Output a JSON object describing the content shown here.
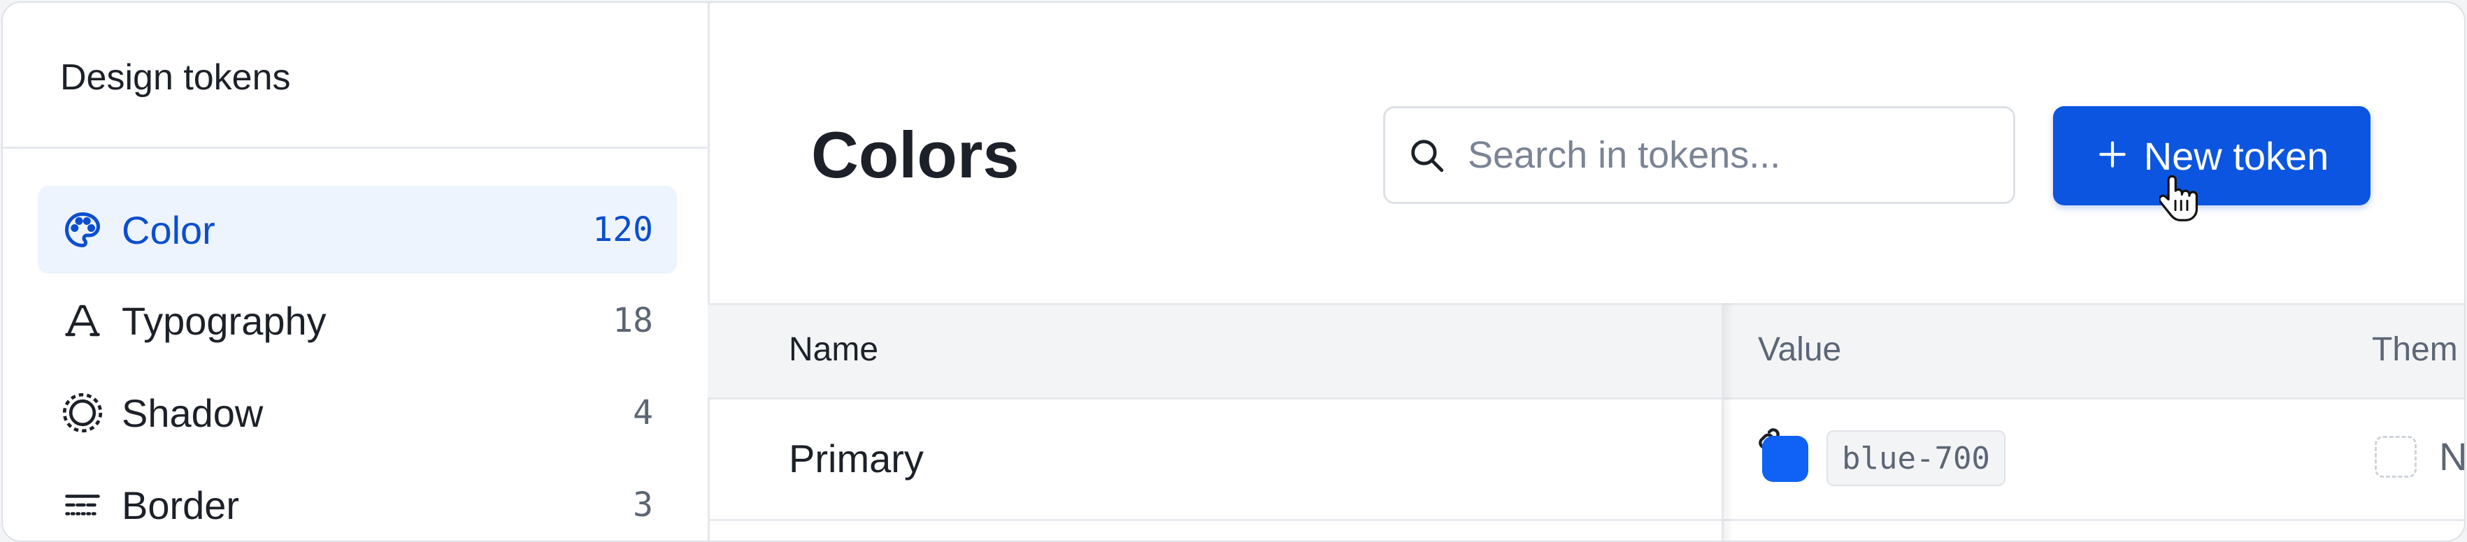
{
  "sidebar": {
    "title": "Design tokens",
    "items": [
      {
        "label": "Color",
        "count": "120",
        "icon": "palette-icon"
      },
      {
        "label": "Typography",
        "count": "18",
        "icon": "typography-icon"
      },
      {
        "label": "Shadow",
        "count": "4",
        "icon": "shadow-icon"
      },
      {
        "label": "Border",
        "count": "3",
        "icon": "border-icon"
      }
    ]
  },
  "main": {
    "title": "Colors",
    "search": {
      "placeholder": "Search in tokens..."
    },
    "new_button": {
      "label": "New token"
    }
  },
  "table": {
    "headers": {
      "name": "Name",
      "value": "Value",
      "theme": "Them"
    },
    "rows": [
      {
        "name": "Primary",
        "value": "blue-700",
        "theme": "N"
      }
    ]
  },
  "colors": {
    "accent": "#0b55e0",
    "active_bg": "#eef4fd",
    "swatch": "#0f62f5"
  }
}
